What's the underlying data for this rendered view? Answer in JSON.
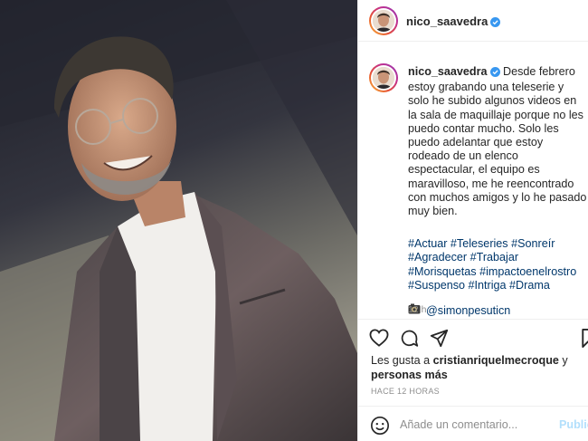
{
  "post": {
    "username": "nico_saavedra",
    "caption_text": "Desde febrero estoy grabando una teleserie y solo he subido algunos videos en la sala de maquillaje porque no les puedo contar mucho. Solo les puedo adelantar que estoy rodeado de un elenco espectacular, el equipo es maravilloso, me he reencontrado con muchos amigos y lo he pasado muy bien.",
    "hashtags": [
      "#Actuar",
      "#Teleseries",
      "#Sonreír",
      "#Agradecer",
      "#Trabajar",
      "#Morisquetas",
      "#impactoenelrostro",
      "#Suspenso",
      "#Intriga",
      "#Drama"
    ],
    "mention": "@simonpesuticn",
    "time_short": "12 h",
    "likes_prefix": "Les gusta a",
    "likes_user": "cristianriquelmecroque",
    "likes_and": "y",
    "likes_others": "personas más",
    "time_ago": "HACE 12 HORAS"
  },
  "comment": {
    "placeholder": "Añade un comentario...",
    "post_label": "Publicar"
  },
  "colors": {
    "link": "#00376b",
    "verified": "#3897f0",
    "muted": "#8e8e8e",
    "post_disabled": "#b2dffc"
  }
}
